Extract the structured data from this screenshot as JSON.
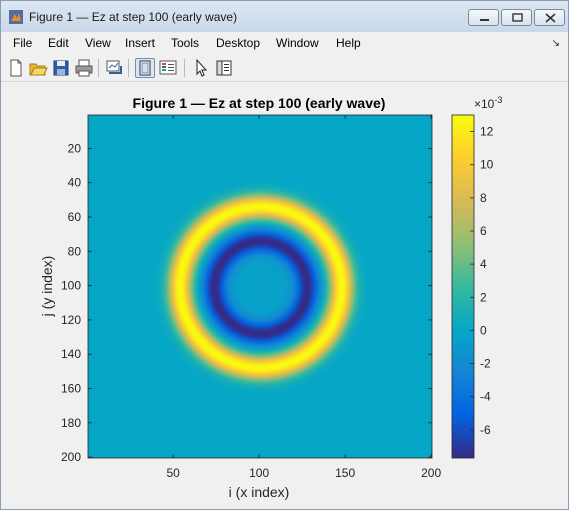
{
  "window": {
    "title": "Figure 1 — Ez at step 100 (early wave)"
  },
  "menu": {
    "items": [
      "File",
      "Edit",
      "View",
      "Insert",
      "Tools",
      "Desktop",
      "Window",
      "Help"
    ]
  },
  "toolbar": {
    "buttons": [
      {
        "icon": "new-figure-icon"
      },
      {
        "icon": "open-file-icon"
      },
      {
        "icon": "save-icon"
      },
      {
        "icon": "print-icon"
      },
      {
        "icon": "link-plot-icon"
      },
      {
        "icon": "hide-plot-tools-icon",
        "pressed": true
      },
      {
        "icon": "insert-colorbar-icon"
      },
      {
        "icon": "select-arrow-icon"
      },
      {
        "icon": "show-plot-tools-icon"
      }
    ]
  },
  "chart_data": {
    "type": "heatmap",
    "title": "Figure 1 — Ez at step 100 (early wave)",
    "xlabel": "i (x index)",
    "ylabel": "j (y index)",
    "x_ticks": [
      50,
      100,
      150,
      200
    ],
    "y_ticks": [
      20,
      40,
      60,
      80,
      100,
      120,
      140,
      160,
      180,
      200
    ],
    "xlim": [
      0.5,
      200.5
    ],
    "ylim": [
      0.5,
      200.5
    ],
    "y_direction": "reversed",
    "colormap": "parula",
    "colorbar": {
      "ticks": [
        12,
        10,
        8,
        6,
        4,
        2,
        0,
        -2,
        -4,
        -6
      ],
      "exponent_label": "×10",
      "exponent_power": "-3",
      "range": [
        -7.7,
        13
      ]
    },
    "field": {
      "center": [
        101,
        101
      ],
      "background_value": 0,
      "inner_value": -0.5,
      "trough": {
        "radius": 27,
        "width": 7,
        "value": -7.7
      },
      "crest": {
        "radius": 47,
        "width": 7,
        "value": 13
      }
    }
  },
  "colors": {
    "parula_stops": [
      "#352a87",
      "#0363e1",
      "#1485d4",
      "#06a7c6",
      "#38b99e",
      "#92bf73",
      "#d9ba56",
      "#fcce2e",
      "#f9fb0e"
    ]
  }
}
